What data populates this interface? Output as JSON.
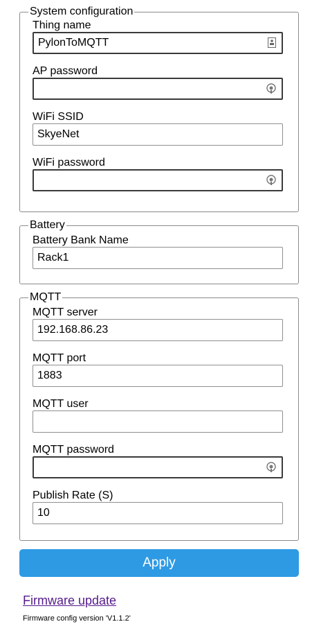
{
  "system": {
    "legend": "System configuration",
    "thing_name": {
      "label": "Thing name",
      "value": "PylonToMQTT"
    },
    "ap_password": {
      "label": "AP password",
      "value": ""
    },
    "wifi_ssid": {
      "label": "WiFi SSID",
      "value": "SkyeNet"
    },
    "wifi_password": {
      "label": "WiFi password",
      "value": ""
    }
  },
  "battery": {
    "legend": "Battery",
    "bank_name": {
      "label": "Battery Bank Name",
      "value": "Rack1"
    }
  },
  "mqtt": {
    "legend": "MQTT",
    "server": {
      "label": "MQTT server",
      "value": "192.168.86.23"
    },
    "port": {
      "label": "MQTT port",
      "value": "1883"
    },
    "user": {
      "label": "MQTT user",
      "value": ""
    },
    "password": {
      "label": "MQTT password",
      "value": ""
    },
    "publish_rate": {
      "label": "Publish Rate (S)",
      "value": "10"
    }
  },
  "apply_label": "Apply",
  "firmware_update_label": "Firmware update",
  "firmware_version_text": "Firmware config version 'V1.1.2'",
  "icons": {
    "password_reveal": "password-reveal-icon",
    "contact_card": "contact-card-icon"
  },
  "colors": {
    "apply_bg": "#2e9ae4",
    "link": "#551a8b"
  }
}
